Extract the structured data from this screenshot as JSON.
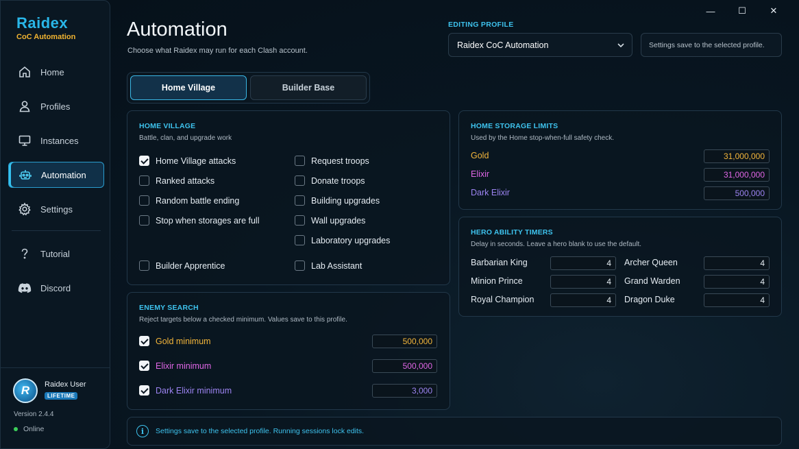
{
  "brand": {
    "title": "Raidex",
    "subtitle": "CoC Automation"
  },
  "sidebar": {
    "items": [
      {
        "label": "Home",
        "icon": "home-icon"
      },
      {
        "label": "Profiles",
        "icon": "user-icon"
      },
      {
        "label": "Instances",
        "icon": "monitor-icon"
      },
      {
        "label": "Automation",
        "icon": "robot-icon",
        "active": true
      },
      {
        "label": "Settings",
        "icon": "gear-icon"
      },
      {
        "label": "Tutorial",
        "icon": "question-icon"
      },
      {
        "label": "Discord",
        "icon": "discord-icon"
      }
    ],
    "user": {
      "name": "Raidex User",
      "badge": "LIFETIME",
      "avatar_letter": "R"
    },
    "version": "Version 2.4.4",
    "status": "Online"
  },
  "header": {
    "title": "Automation",
    "subtitle": "Choose what Raidex may run for each Clash account.",
    "profile_label": "EDITING PROFILE",
    "profile_value": "Raidex CoC Automation",
    "save_note": "Settings save to the selected profile."
  },
  "window_controls": {
    "minimize": "—",
    "maximize": "☐",
    "close": "✕"
  },
  "tabs": {
    "home": "Home Village",
    "builder": "Builder Base"
  },
  "home_village": {
    "title": "HOME VILLAGE",
    "subtitle": "Battle, clan, and upgrade work",
    "left": [
      {
        "label": "Home Village attacks",
        "checked": true
      },
      {
        "label": "Ranked attacks",
        "checked": false
      },
      {
        "label": "Random battle ending",
        "checked": false
      },
      {
        "label": "Stop when storages are full",
        "checked": false
      },
      {
        "label": "Builder Apprentice",
        "checked": false
      }
    ],
    "right": [
      {
        "label": "Request troops",
        "checked": false
      },
      {
        "label": "Donate troops",
        "checked": false
      },
      {
        "label": "Building upgrades",
        "checked": false
      },
      {
        "label": "Wall upgrades",
        "checked": false
      },
      {
        "label": "Laboratory upgrades",
        "checked": false
      },
      {
        "label": "Lab Assistant",
        "checked": false
      }
    ]
  },
  "enemy_search": {
    "title": "ENEMY SEARCH",
    "subtitle": "Reject targets below a checked minimum. Values save to this profile.",
    "rows": [
      {
        "label": "Gold minimum",
        "value": "500,000",
        "checked": true,
        "color": "#f4b63b"
      },
      {
        "label": "Elixir minimum",
        "value": "500,000",
        "checked": true,
        "color": "#e066e6"
      },
      {
        "label": "Dark Elixir minimum",
        "value": "3,000",
        "checked": true,
        "color": "#9d84f2"
      }
    ]
  },
  "storage_limits": {
    "title": "HOME STORAGE LIMITS",
    "subtitle": "Used by the Home stop-when-full safety check.",
    "rows": [
      {
        "label": "Gold",
        "value": "31,000,000",
        "color": "#f4b63b"
      },
      {
        "label": "Elixir",
        "value": "31,000,000",
        "color": "#e066e6"
      },
      {
        "label": "Dark Elixir",
        "value": "500,000",
        "color": "#9d84f2"
      }
    ]
  },
  "hero_timers": {
    "title": "HERO ABILITY TIMERS",
    "subtitle": "Delay in seconds. Leave a hero blank to use the default.",
    "heroes": [
      {
        "label": "Barbarian King",
        "value": "4"
      },
      {
        "label": "Archer Queen",
        "value": "4"
      },
      {
        "label": "Minion Prince",
        "value": "4"
      },
      {
        "label": "Grand Warden",
        "value": "4"
      },
      {
        "label": "Royal Champion",
        "value": "4"
      },
      {
        "label": "Dragon Duke",
        "value": "4"
      }
    ]
  },
  "footer": {
    "info": "Settings save to the selected profile. Running sessions lock edits.",
    "info_icon": "i"
  }
}
